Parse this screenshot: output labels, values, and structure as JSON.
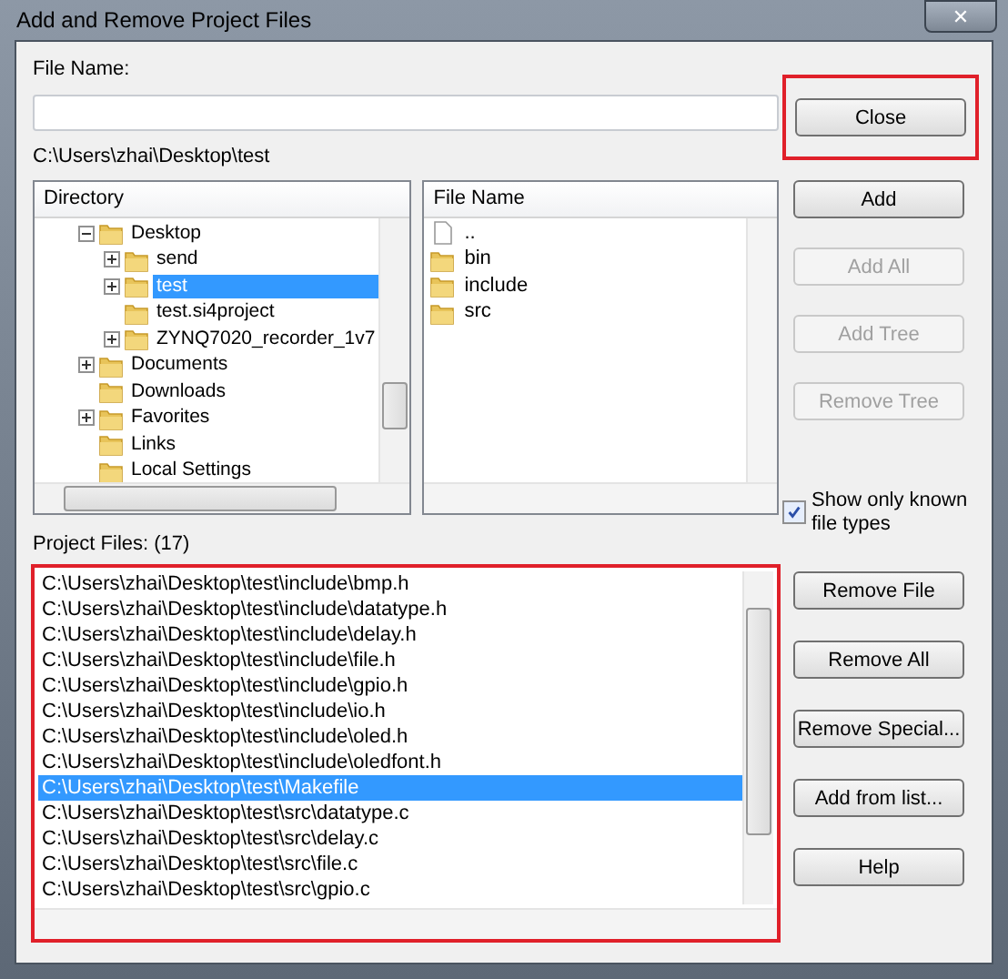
{
  "window": {
    "title": "Add and Remove Project Files",
    "close_glyph": "✕"
  },
  "file_name": {
    "label": "File Name:"
  },
  "current_path": "C:\\Users\\zhai\\Desktop\\test",
  "directory": {
    "header": "Directory",
    "items": [
      {
        "name": "Desktop",
        "expanded": true,
        "selected": false,
        "children": [
          {
            "name": "send",
            "expanded": false,
            "selected": false
          },
          {
            "name": "test",
            "expanded": false,
            "selected": true
          },
          {
            "name": "test.si4project",
            "selected": false
          },
          {
            "name": "ZYNQ7020_recorder_1v7",
            "expanded": false,
            "selected": false
          }
        ]
      },
      {
        "name": "Documents",
        "expanded": false,
        "selected": false
      },
      {
        "name": "Downloads",
        "selected": false
      },
      {
        "name": "Favorites",
        "expanded": false,
        "selected": false
      },
      {
        "name": "Links",
        "selected": false
      },
      {
        "name": "Local Settings",
        "selected": false
      }
    ]
  },
  "files": {
    "header": "File Name",
    "items": [
      {
        "name": "..",
        "kind": "parent"
      },
      {
        "name": "bin",
        "kind": "folder"
      },
      {
        "name": "include",
        "kind": "folder"
      },
      {
        "name": "src",
        "kind": "folder"
      }
    ]
  },
  "top_buttons": [
    {
      "label": "Close",
      "disabled": false,
      "highlighted": true
    }
  ],
  "side_buttons": [
    {
      "label": "Add",
      "disabled": false
    },
    {
      "label": "Add All",
      "disabled": true
    },
    {
      "label": "Add Tree",
      "disabled": true
    },
    {
      "label": "Remove Tree",
      "disabled": true
    }
  ],
  "known_types": {
    "label": "Show only known file types",
    "checked": true
  },
  "project_files": {
    "label": "Project Files: (17)",
    "highlighted": true,
    "rows": [
      {
        "path": "C:\\Users\\zhai\\Desktop\\test\\include\\bmp.h",
        "selected": false
      },
      {
        "path": "C:\\Users\\zhai\\Desktop\\test\\include\\datatype.h",
        "selected": false
      },
      {
        "path": "C:\\Users\\zhai\\Desktop\\test\\include\\delay.h",
        "selected": false
      },
      {
        "path": "C:\\Users\\zhai\\Desktop\\test\\include\\file.h",
        "selected": false
      },
      {
        "path": "C:\\Users\\zhai\\Desktop\\test\\include\\gpio.h",
        "selected": false
      },
      {
        "path": "C:\\Users\\zhai\\Desktop\\test\\include\\io.h",
        "selected": false
      },
      {
        "path": "C:\\Users\\zhai\\Desktop\\test\\include\\oled.h",
        "selected": false
      },
      {
        "path": "C:\\Users\\zhai\\Desktop\\test\\include\\oledfont.h",
        "selected": false
      },
      {
        "path": "C:\\Users\\zhai\\Desktop\\test\\Makefile",
        "selected": true
      },
      {
        "path": "C:\\Users\\zhai\\Desktop\\test\\src\\datatype.c",
        "selected": false
      },
      {
        "path": "C:\\Users\\zhai\\Desktop\\test\\src\\delay.c",
        "selected": false
      },
      {
        "path": "C:\\Users\\zhai\\Desktop\\test\\src\\file.c",
        "selected": false
      },
      {
        "path": "C:\\Users\\zhai\\Desktop\\test\\src\\gpio.c",
        "selected": false
      }
    ]
  },
  "list_buttons": [
    {
      "label": "Remove File",
      "disabled": false
    },
    {
      "label": "Remove All",
      "disabled": false
    },
    {
      "label": "Remove Special...",
      "disabled": false
    },
    {
      "label": "Add from list...",
      "disabled": false
    },
    {
      "label": "Help",
      "disabled": false
    }
  ]
}
